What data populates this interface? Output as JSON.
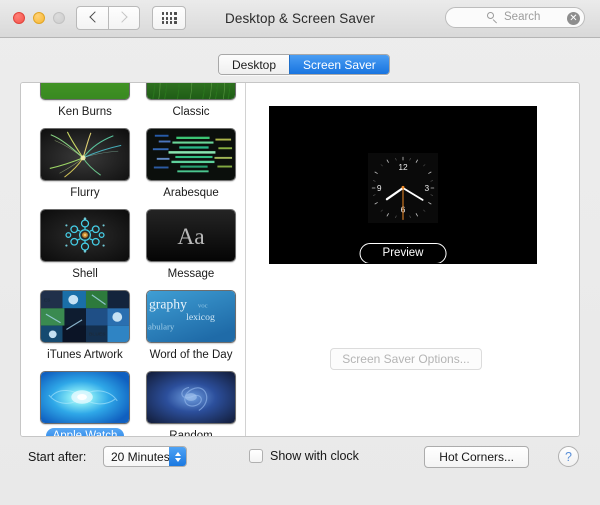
{
  "window": {
    "title": "Desktop & Screen Saver",
    "traffic_lights": [
      "close",
      "minimize",
      "zoom"
    ],
    "nav": {
      "back": "back-arrow",
      "forward": "forward-arrow",
      "grid": "show-all-grid"
    }
  },
  "search": {
    "placeholder": "Search",
    "value": "",
    "icon": "search-icon",
    "clear_icon": "clear-icon"
  },
  "tabs": [
    {
      "label": "Desktop",
      "active": false
    },
    {
      "label": "Screen Saver",
      "active": true
    }
  ],
  "savers": [
    {
      "label": "Ken Burns",
      "selected": false,
      "art": "kenburns"
    },
    {
      "label": "Classic",
      "selected": false,
      "art": "classic"
    },
    {
      "label": "Flurry",
      "selected": false,
      "art": "flurry"
    },
    {
      "label": "Arabesque",
      "selected": false,
      "art": "arabesque"
    },
    {
      "label": "Shell",
      "selected": false,
      "art": "shell"
    },
    {
      "label": "Message",
      "selected": false,
      "art": "message"
    },
    {
      "label": "iTunes Artwork",
      "selected": false,
      "art": "itunes"
    },
    {
      "label": "Word of the Day",
      "selected": false,
      "art": "word"
    },
    {
      "label": "Apple Watch",
      "selected": true,
      "art": "applewatch"
    },
    {
      "label": "Random",
      "selected": false,
      "art": "random"
    }
  ],
  "preview": {
    "button_label": "Preview",
    "options_label": "Screen Saver Options...",
    "options_disabled": true,
    "clock": {
      "hour_numbers": [
        "12",
        "3",
        "6",
        "9"
      ],
      "hand_color": "#ffffff",
      "second_hand_color": "#f28c28",
      "background": "#000000"
    }
  },
  "bottom": {
    "start_after_label": "Start after:",
    "start_after_value": "20 Minutes",
    "show_with_clock_label": "Show with clock",
    "show_with_clock_checked": false,
    "hot_corners_label": "Hot Corners...",
    "help_label": "?"
  },
  "colors": {
    "accent": "#1f7de3",
    "tab_active_bg": "#1874e0",
    "selected_pill": "#1f7de3",
    "preview_bg": "#000000",
    "second_hand": "#f28c28"
  }
}
